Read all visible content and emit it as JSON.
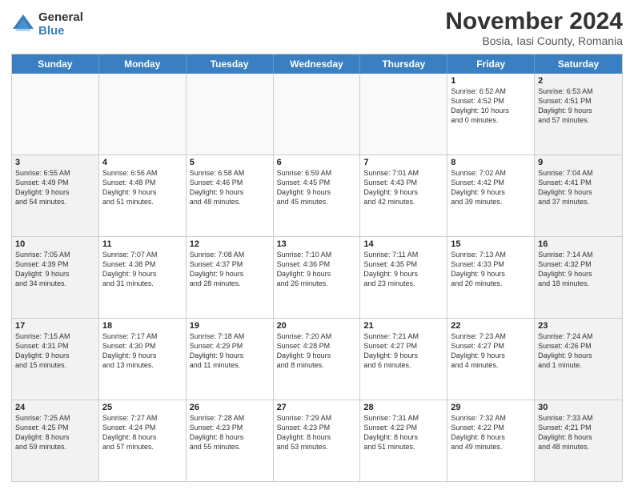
{
  "logo": {
    "general": "General",
    "blue": "Blue"
  },
  "title": "November 2024",
  "subtitle": "Bosia, Iasi County, Romania",
  "days": [
    "Sunday",
    "Monday",
    "Tuesday",
    "Wednesday",
    "Thursday",
    "Friday",
    "Saturday"
  ],
  "weeks": [
    [
      {
        "day": "",
        "info": ""
      },
      {
        "day": "",
        "info": ""
      },
      {
        "day": "",
        "info": ""
      },
      {
        "day": "",
        "info": ""
      },
      {
        "day": "",
        "info": ""
      },
      {
        "day": "1",
        "info": "Sunrise: 6:52 AM\nSunset: 4:52 PM\nDaylight: 10 hours\nand 0 minutes."
      },
      {
        "day": "2",
        "info": "Sunrise: 6:53 AM\nSunset: 4:51 PM\nDaylight: 9 hours\nand 57 minutes."
      }
    ],
    [
      {
        "day": "3",
        "info": "Sunrise: 6:55 AM\nSunset: 4:49 PM\nDaylight: 9 hours\nand 54 minutes."
      },
      {
        "day": "4",
        "info": "Sunrise: 6:56 AM\nSunset: 4:48 PM\nDaylight: 9 hours\nand 51 minutes."
      },
      {
        "day": "5",
        "info": "Sunrise: 6:58 AM\nSunset: 4:46 PM\nDaylight: 9 hours\nand 48 minutes."
      },
      {
        "day": "6",
        "info": "Sunrise: 6:59 AM\nSunset: 4:45 PM\nDaylight: 9 hours\nand 45 minutes."
      },
      {
        "day": "7",
        "info": "Sunrise: 7:01 AM\nSunset: 4:43 PM\nDaylight: 9 hours\nand 42 minutes."
      },
      {
        "day": "8",
        "info": "Sunrise: 7:02 AM\nSunset: 4:42 PM\nDaylight: 9 hours\nand 39 minutes."
      },
      {
        "day": "9",
        "info": "Sunrise: 7:04 AM\nSunset: 4:41 PM\nDaylight: 9 hours\nand 37 minutes."
      }
    ],
    [
      {
        "day": "10",
        "info": "Sunrise: 7:05 AM\nSunset: 4:39 PM\nDaylight: 9 hours\nand 34 minutes."
      },
      {
        "day": "11",
        "info": "Sunrise: 7:07 AM\nSunset: 4:38 PM\nDaylight: 9 hours\nand 31 minutes."
      },
      {
        "day": "12",
        "info": "Sunrise: 7:08 AM\nSunset: 4:37 PM\nDaylight: 9 hours\nand 28 minutes."
      },
      {
        "day": "13",
        "info": "Sunrise: 7:10 AM\nSunset: 4:36 PM\nDaylight: 9 hours\nand 26 minutes."
      },
      {
        "day": "14",
        "info": "Sunrise: 7:11 AM\nSunset: 4:35 PM\nDaylight: 9 hours\nand 23 minutes."
      },
      {
        "day": "15",
        "info": "Sunrise: 7:13 AM\nSunset: 4:33 PM\nDaylight: 9 hours\nand 20 minutes."
      },
      {
        "day": "16",
        "info": "Sunrise: 7:14 AM\nSunset: 4:32 PM\nDaylight: 9 hours\nand 18 minutes."
      }
    ],
    [
      {
        "day": "17",
        "info": "Sunrise: 7:15 AM\nSunset: 4:31 PM\nDaylight: 9 hours\nand 15 minutes."
      },
      {
        "day": "18",
        "info": "Sunrise: 7:17 AM\nSunset: 4:30 PM\nDaylight: 9 hours\nand 13 minutes."
      },
      {
        "day": "19",
        "info": "Sunrise: 7:18 AM\nSunset: 4:29 PM\nDaylight: 9 hours\nand 11 minutes."
      },
      {
        "day": "20",
        "info": "Sunrise: 7:20 AM\nSunset: 4:28 PM\nDaylight: 9 hours\nand 8 minutes."
      },
      {
        "day": "21",
        "info": "Sunrise: 7:21 AM\nSunset: 4:27 PM\nDaylight: 9 hours\nand 6 minutes."
      },
      {
        "day": "22",
        "info": "Sunrise: 7:23 AM\nSunset: 4:27 PM\nDaylight: 9 hours\nand 4 minutes."
      },
      {
        "day": "23",
        "info": "Sunrise: 7:24 AM\nSunset: 4:26 PM\nDaylight: 9 hours\nand 1 minute."
      }
    ],
    [
      {
        "day": "24",
        "info": "Sunrise: 7:25 AM\nSunset: 4:25 PM\nDaylight: 8 hours\nand 59 minutes."
      },
      {
        "day": "25",
        "info": "Sunrise: 7:27 AM\nSunset: 4:24 PM\nDaylight: 8 hours\nand 57 minutes."
      },
      {
        "day": "26",
        "info": "Sunrise: 7:28 AM\nSunset: 4:23 PM\nDaylight: 8 hours\nand 55 minutes."
      },
      {
        "day": "27",
        "info": "Sunrise: 7:29 AM\nSunset: 4:23 PM\nDaylight: 8 hours\nand 53 minutes."
      },
      {
        "day": "28",
        "info": "Sunrise: 7:31 AM\nSunset: 4:22 PM\nDaylight: 8 hours\nand 51 minutes."
      },
      {
        "day": "29",
        "info": "Sunrise: 7:32 AM\nSunset: 4:22 PM\nDaylight: 8 hours\nand 49 minutes."
      },
      {
        "day": "30",
        "info": "Sunrise: 7:33 AM\nSunset: 4:21 PM\nDaylight: 8 hours\nand 48 minutes."
      }
    ]
  ]
}
